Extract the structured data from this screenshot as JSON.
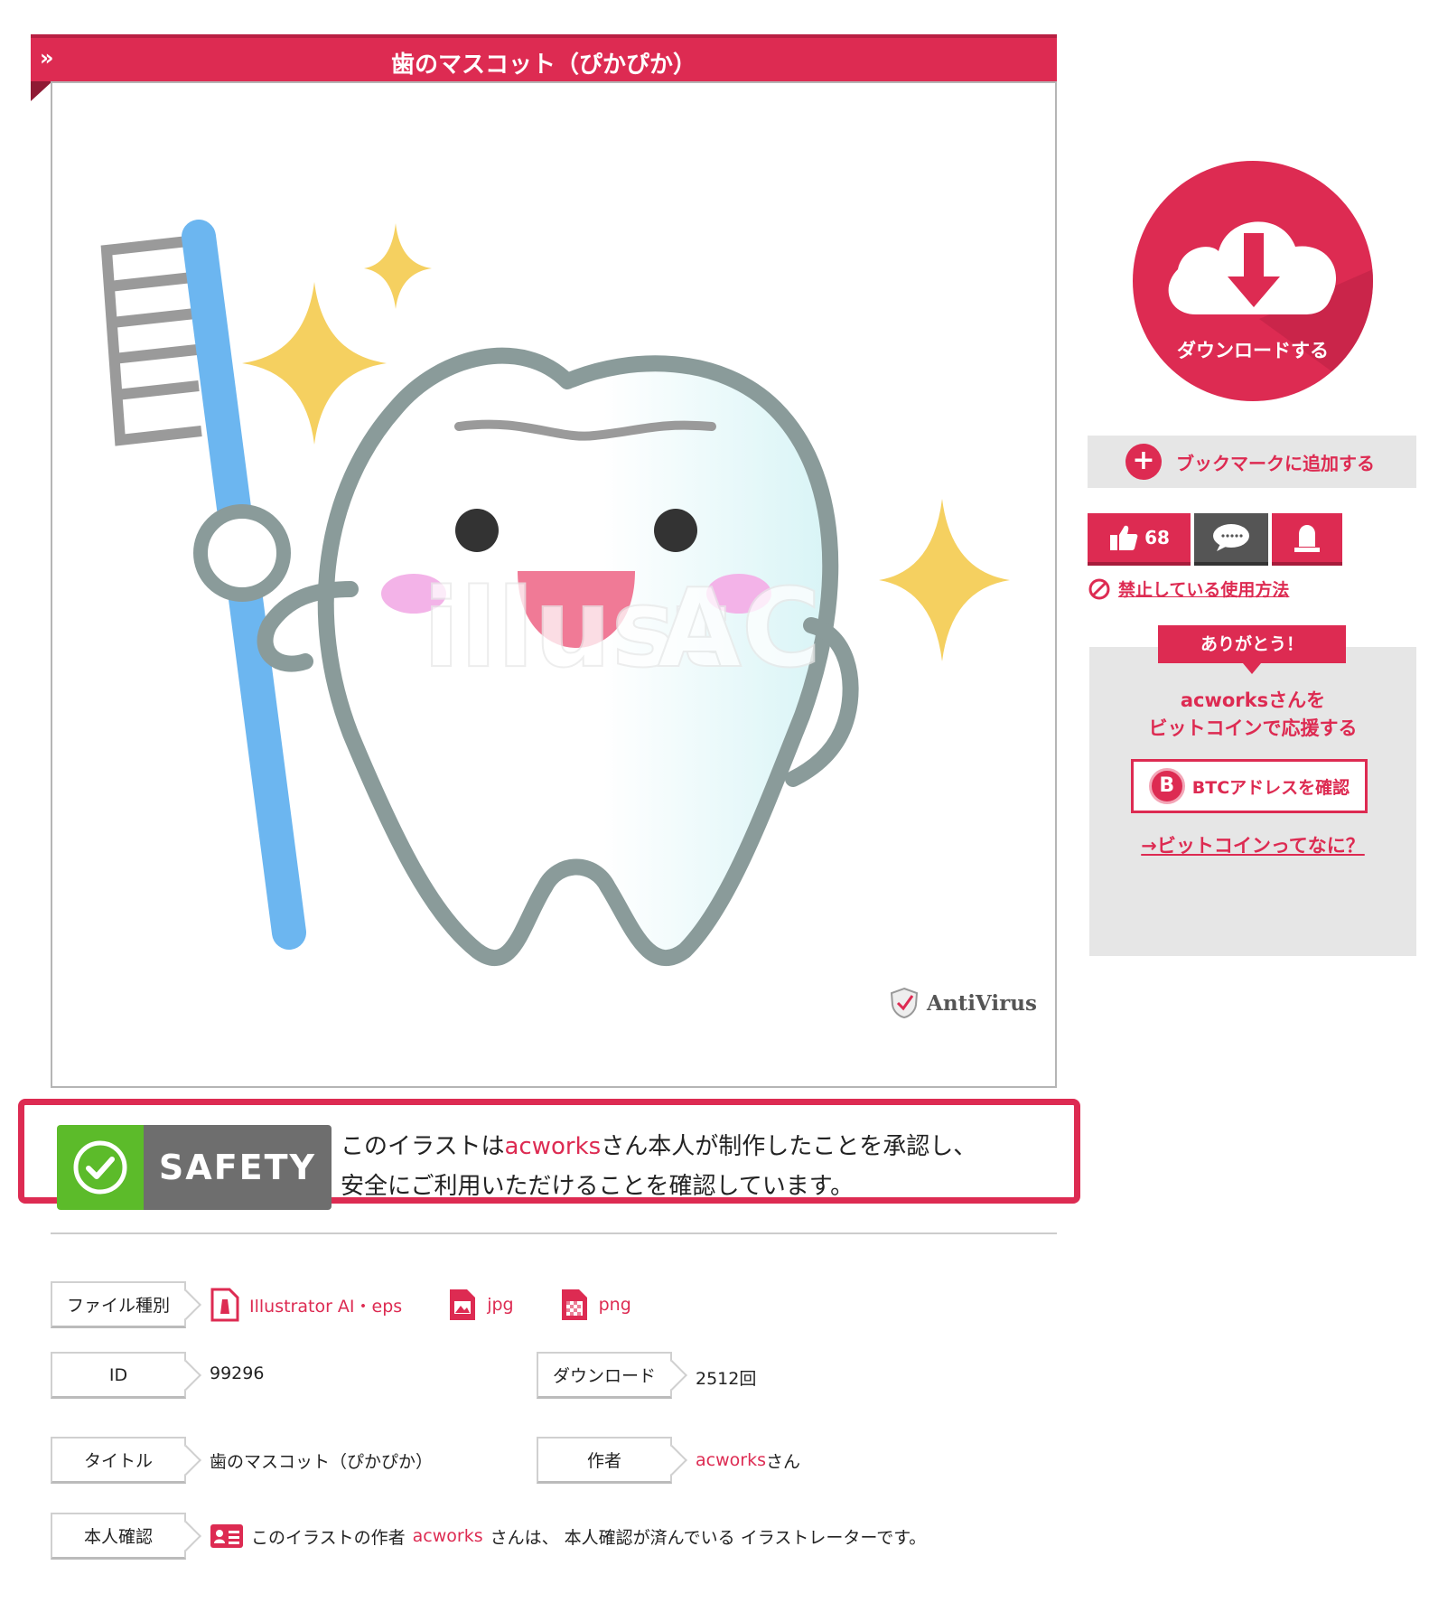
{
  "header": {
    "chevron": "»",
    "title": "歯のマスコット（ぴかぴか）"
  },
  "image": {
    "watermark_left": "illust",
    "watermark_right": "AC",
    "antivirus_label": "AntiVirus"
  },
  "sidebar": {
    "download_label": "ダウンロードする",
    "bookmark_label": "ブックマークに追加する",
    "like_count": "68",
    "prohibited_label": "禁止している使用方法",
    "thanks_label": "ありがとう！",
    "support_line1": "acworksさんを",
    "support_line2": "ビットコインで応援する",
    "btc_coin": "B",
    "btc_button_label": "BTCアドレスを確認",
    "btc_what_label": "→ビットコインってなに？"
  },
  "safety": {
    "badge_label": "SAFETY",
    "text_before": "このイラストは",
    "author": "acworks",
    "text_after": "さん本人が制作したことを承認し、",
    "line2": "安全にご利用いただけることを確認しています。"
  },
  "info": {
    "file_type_label": "ファイル種別",
    "file_types": [
      "Illustrator AI・eps",
      "jpg",
      "png"
    ],
    "id_label": "ID",
    "id_value": "99296",
    "download_count_label": "ダウンロード",
    "download_count_value": "2512回",
    "title_label": "タイトル",
    "title_value": "歯のマスコット（ぴかぴか）",
    "author_label": "作者",
    "author_name": "acworks",
    "author_suffix": "さん",
    "verify_label": "本人確認",
    "verify_before": "このイラストの作者",
    "verify_author": "acworks",
    "verify_after": "さんは、 本人確認が済んでいる イラストレーターです。"
  },
  "colors": {
    "accent": "#dd2b52",
    "safety_green": "#5cbb2a",
    "toothbrush_blue": "#6cb6f0",
    "sparkle": "#f5d060"
  }
}
